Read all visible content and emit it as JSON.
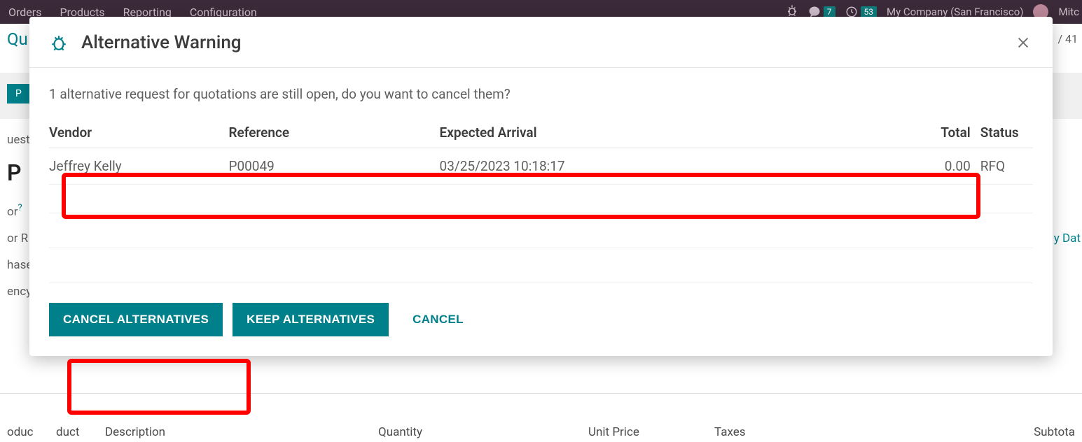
{
  "background": {
    "nav": [
      "Orders",
      "Products",
      "Reporting",
      "Configuration"
    ],
    "msg_count": "7",
    "activity_count": "53",
    "company": "My Company (San Francisco)",
    "user_short": "Mitc",
    "breadcrumb_root": "Qu",
    "page_count": "/ 41",
    "tag": "P",
    "request_label_frag": "uest",
    "doc_title_frag": "P",
    "vendor_label_frag": "or",
    "vendor_q": "?",
    "vendor_ref_frag": "or R",
    "purchase_frag": "hase",
    "currency_frag": "ency",
    "date_link_frag": "y Dat",
    "table_head": {
      "product": "oduc",
      "duct": "duct",
      "description": "Description",
      "quantity": "Quantity",
      "unit_price": "Unit Price",
      "taxes": "Taxes",
      "subtotal": "Subtota"
    }
  },
  "modal": {
    "title": "Alternative Warning",
    "message": "1 alternative request for quotations are still open, do you want to cancel them?",
    "columns": {
      "vendor": "Vendor",
      "reference": "Reference",
      "expected_arrival": "Expected Arrival",
      "total": "Total",
      "status": "Status"
    },
    "rows": [
      {
        "vendor": "Jeffrey Kelly",
        "reference": "P00049",
        "expected_arrival": "03/25/2023 10:18:17",
        "total": "0.00",
        "status": "RFQ"
      }
    ],
    "buttons": {
      "cancel_alt": "CANCEL ALTERNATIVES",
      "keep_alt": "KEEP ALTERNATIVES",
      "cancel": "CANCEL"
    }
  }
}
